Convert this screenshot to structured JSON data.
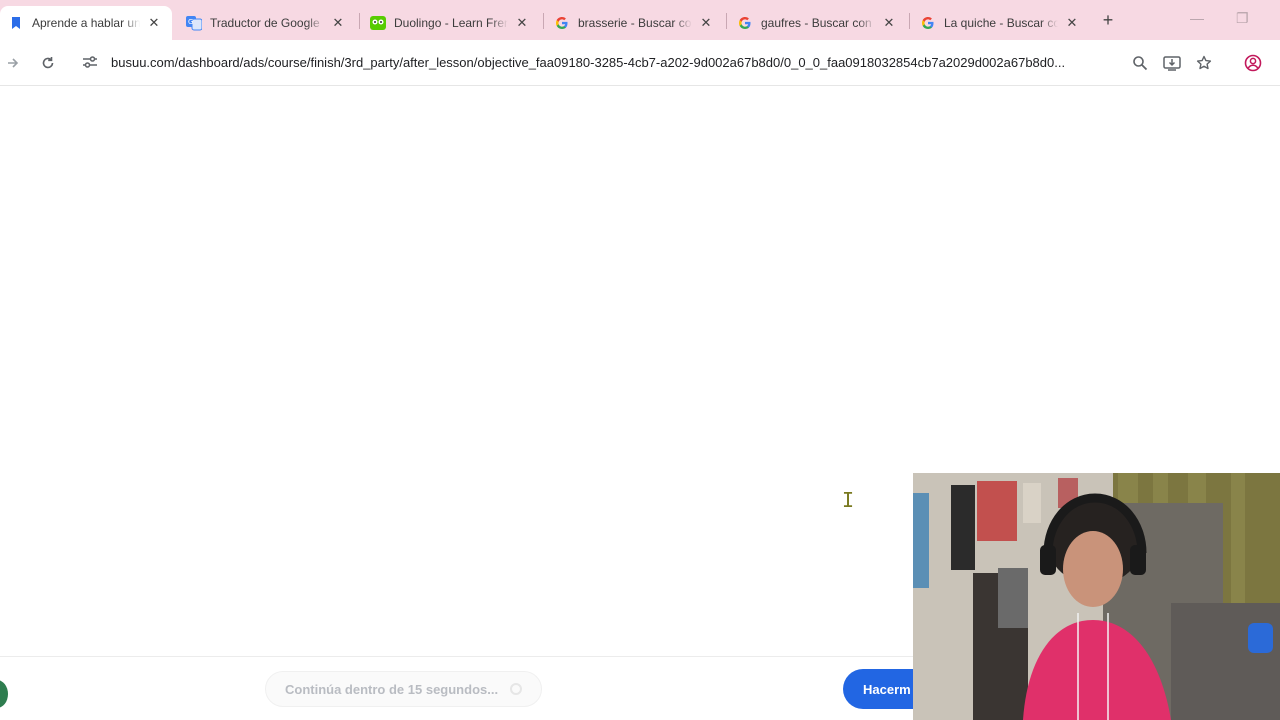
{
  "tabs": [
    {
      "title": "Aprende a hablar un idioma",
      "favicon": "busuu-icon",
      "active": true
    },
    {
      "title": "Traductor de Google",
      "favicon": "google-translate-icon",
      "active": false
    },
    {
      "title": "Duolingo - Learn French",
      "favicon": "duolingo-icon",
      "active": false
    },
    {
      "title": "brasserie - Buscar con Google",
      "favicon": "google-icon",
      "active": false
    },
    {
      "title": "gaufres - Buscar con Google",
      "favicon": "google-icon",
      "active": false
    },
    {
      "title": "La quiche - Buscar con Google",
      "favicon": "google-icon",
      "active": false
    }
  ],
  "toolbar": {
    "url": "busuu.com/dashboard/ads/course/finish/3rd_party/after_lesson/objective_faa09180-3285-4cb7-a202-9d002a67b8d0/0_0_0_faa0918032854cb7a2029d002a67b8d0..."
  },
  "footer": {
    "continue_label": "Continúa dentro de 15 segundos...",
    "cta_label": "Hacerm"
  },
  "colors": {
    "tabstrip": "#f7d9e3",
    "accent_blue": "#2266e3",
    "google_blue": "#4285f4",
    "duolingo_green": "#58cc02"
  }
}
